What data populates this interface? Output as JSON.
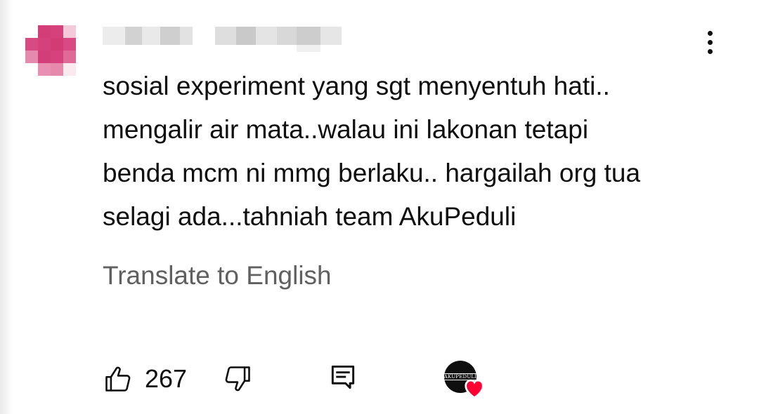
{
  "comment": {
    "username": "",
    "text": "sosial experiment yang sgt menyentuh hati..\nmengalir air mata..walau ini lakonan tetapi\nbenda mcm ni mmg berlaku.. hargailah org tua\nselagi ada...tahniah team AkuPeduli",
    "translate_label": "Translate to English"
  },
  "actions": {
    "like_count": "267"
  },
  "creator_heart": {
    "logo_text": "AKUPEDULI"
  },
  "colors": {
    "text_primary": "#0f0f0f",
    "text_secondary": "#606060",
    "heart": "#ff0033",
    "avatar_pink": "#d5417a"
  }
}
